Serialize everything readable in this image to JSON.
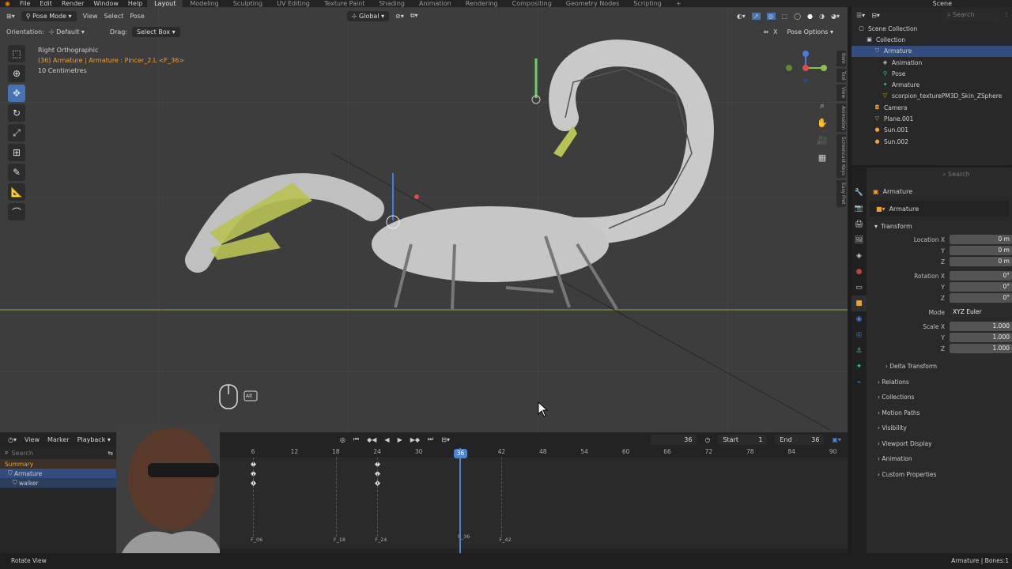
{
  "menubar": {
    "items": [
      "File",
      "Edit",
      "Render",
      "Window",
      "Help"
    ],
    "workspaces": [
      "Layout",
      "Modeling",
      "Sculpting",
      "UV Editing",
      "Texture Paint",
      "Shading",
      "Animation",
      "Rendering",
      "Compositing",
      "Geometry Nodes",
      "Scripting"
    ],
    "active_workspace": "Layout",
    "scene_label": "Scene",
    "search_placeholder": "Search"
  },
  "viewport": {
    "mode": "Pose Mode",
    "menus": [
      "View",
      "Select",
      "Pose"
    ],
    "transform_orientation": "Global",
    "orientation_label": "Orientation:",
    "orientation_value": "Default",
    "drag_label": "Drag:",
    "drag_value": "Select Box",
    "pose_options": "Pose Options",
    "view_name": "Right Orthographic",
    "context_line": "(36) Armature | Armature : Pincer_2.L <F_36>",
    "scale_text": "10 Centimetres",
    "side_tabs": [
      "Item",
      "Tool",
      "View",
      "Animation",
      "Screencast Keys",
      "Easy Fret"
    ],
    "alt_key": "Alt"
  },
  "outliner": {
    "search_placeholder": "Search",
    "rows": [
      {
        "label": "Scene Collection",
        "icon": "scene-collection-icon",
        "indent": 0
      },
      {
        "label": "Collection",
        "icon": "collection-icon",
        "indent": 1
      },
      {
        "label": "Armature",
        "icon": "armature-icon",
        "indent": 2,
        "selected": true
      },
      {
        "label": "Animation",
        "icon": "animation-icon",
        "indent": 3
      },
      {
        "label": "Pose",
        "icon": "pose-icon",
        "indent": 3
      },
      {
        "label": "Armature",
        "icon": "armature-data-icon",
        "indent": 3
      },
      {
        "label": "scorpion_texturePM3D_Skin_ZSphere",
        "icon": "mesh-icon",
        "indent": 3
      },
      {
        "label": "Camera",
        "icon": "camera-icon",
        "indent": 2
      },
      {
        "label": "Plane.001",
        "icon": "mesh-icon",
        "indent": 2
      },
      {
        "label": "Sun.001",
        "icon": "light-icon",
        "indent": 2
      },
      {
        "label": "Sun.002",
        "icon": "light-icon",
        "indent": 2
      }
    ]
  },
  "properties": {
    "search_placeholder": "Search",
    "context": "Armature",
    "object_name": "Armature",
    "transform_header": "Transform",
    "location": {
      "label": "Location X",
      "x": "0 m",
      "y": "0 m",
      "z": "0 m"
    },
    "rotation": {
      "label": "Rotation X",
      "x": "0°",
      "y": "0°",
      "z": "0°"
    },
    "mode_label": "Mode",
    "mode_value": "XYZ Euler",
    "scale": {
      "label": "Scale X",
      "x": "1.000",
      "y": "1.000",
      "z": "1.000"
    },
    "axis_y": "Y",
    "axis_z": "Z",
    "sections": [
      "Delta Transform",
      "Relations",
      "Collections",
      "Motion Paths",
      "Visibility",
      "Viewport Display",
      "Animation",
      "Custom Properties"
    ]
  },
  "timeline": {
    "menus": [
      "View",
      "Marker",
      "Playback"
    ],
    "current_frame": "36",
    "start_label": "Start",
    "start_value": "1",
    "end_label": "End",
    "end_value": "36",
    "search_placeholder": "Search",
    "channels": [
      "Summary",
      "Armature",
      "walker"
    ],
    "ruler_ticks": [
      "6",
      "12",
      "18",
      "24",
      "30",
      "36",
      "42",
      "48",
      "54",
      "60",
      "66",
      "72",
      "78",
      "84",
      "90"
    ],
    "markers": [
      "F_06",
      "F_18",
      "F_24",
      "F_36",
      "F_42"
    ],
    "playhead_label": "36"
  },
  "statusbar": {
    "left": "Rotate View",
    "right": "Armature | Bones:1"
  },
  "colors": {
    "accent": "#4772b3",
    "selected_row": "#334d80",
    "active_text": "#f0a030",
    "ground_line": "#7a9a3a"
  }
}
